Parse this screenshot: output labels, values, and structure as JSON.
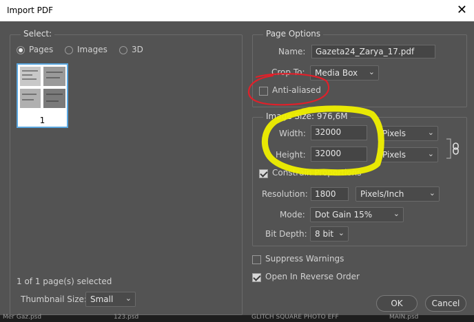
{
  "window": {
    "title": "Import PDF",
    "close_glyph": "✕"
  },
  "select_group": {
    "legend": "Select:",
    "radios": [
      {
        "label": "Pages",
        "checked": true
      },
      {
        "label": "Images",
        "checked": false
      },
      {
        "label": "3D",
        "checked": false
      }
    ],
    "thumbnail": {
      "page_number": "1"
    },
    "selection_status": "1 of 1 page(s) selected",
    "thumbnail_size_label": "Thumbnail Size:",
    "thumbnail_size_value": "Small"
  },
  "page_options": {
    "legend": "Page Options",
    "name_label": "Name:",
    "name_value": "Gazeta24_Zarya_17.pdf",
    "crop_label": "Crop To:",
    "crop_value": "Media Box",
    "anti_aliased_label": "Anti-aliased",
    "anti_aliased_checked": false
  },
  "image_size": {
    "legend": "Image Size: 976,6M",
    "width_label": "Width:",
    "width_value": "32000",
    "width_unit": "Pixels",
    "height_label": "Height:",
    "height_value": "32000",
    "height_unit": "Pixels",
    "constrain_label": "Constrain Proportions",
    "constrain_checked": true,
    "resolution_label": "Resolution:",
    "resolution_value": "1800",
    "resolution_unit": "Pixels/Inch",
    "mode_label": "Mode:",
    "mode_value": "Dot Gain 15%",
    "bit_depth_label": "Bit Depth:",
    "bit_depth_value": "8 bit"
  },
  "options": {
    "suppress_warnings_label": "Suppress Warnings",
    "suppress_warnings_checked": false,
    "reverse_order_label": "Open In Reverse Order",
    "reverse_order_checked": true
  },
  "buttons": {
    "ok": "OK",
    "cancel": "Cancel"
  },
  "background_taskbar": [
    "Mer Gaz.psd",
    "123.psd",
    "GLITCH SQUARE PHOTO EFF",
    "MAIN.psd"
  ],
  "annotation_colors": {
    "red_circle": "#e0202a",
    "yellow_scribble": "#f0f000"
  }
}
